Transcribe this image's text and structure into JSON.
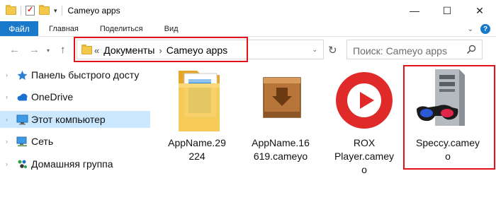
{
  "window": {
    "title": "Cameyo apps"
  },
  "ribbon": {
    "file_tab": "Файл",
    "tabs": [
      "Главная",
      "Поделиться",
      "Вид"
    ]
  },
  "address": {
    "overflow": "«",
    "crumbs": [
      "Документы",
      "Cameyo apps"
    ]
  },
  "search": {
    "placeholder": "Поиск: Cameyo apps"
  },
  "navpane": {
    "items": [
      {
        "label": "Панель быстрого досту",
        "icon": "star-icon"
      },
      {
        "label": "OneDrive",
        "icon": "cloud-icon"
      },
      {
        "label": "Этот компьютер",
        "icon": "computer-icon",
        "selected": true
      },
      {
        "label": "Сеть",
        "icon": "network-icon"
      },
      {
        "label": "Домашняя группа",
        "icon": "homegroup-icon"
      }
    ]
  },
  "files": [
    {
      "name": "AppName.29224",
      "line1": "AppName.29",
      "line2": "224",
      "icon": "document-folder-icon"
    },
    {
      "name": "AppName.16619.cameyo",
      "line1": "AppName.16",
      "line2": "619.cameyo",
      "icon": "package-icon"
    },
    {
      "name": "ROX Player.cameyo",
      "line1": "ROX",
      "line2": "Player.camey",
      "line3": "o",
      "icon": "rox-player-icon"
    },
    {
      "name": "Speccy.cameyo",
      "line1": "Speccy.camey",
      "line2": "o",
      "icon": "speccy-icon",
      "highlighted": true
    }
  ],
  "colors": {
    "accent": "#1979ca",
    "highlight": "#e0121a",
    "selection": "#cce8ff"
  }
}
